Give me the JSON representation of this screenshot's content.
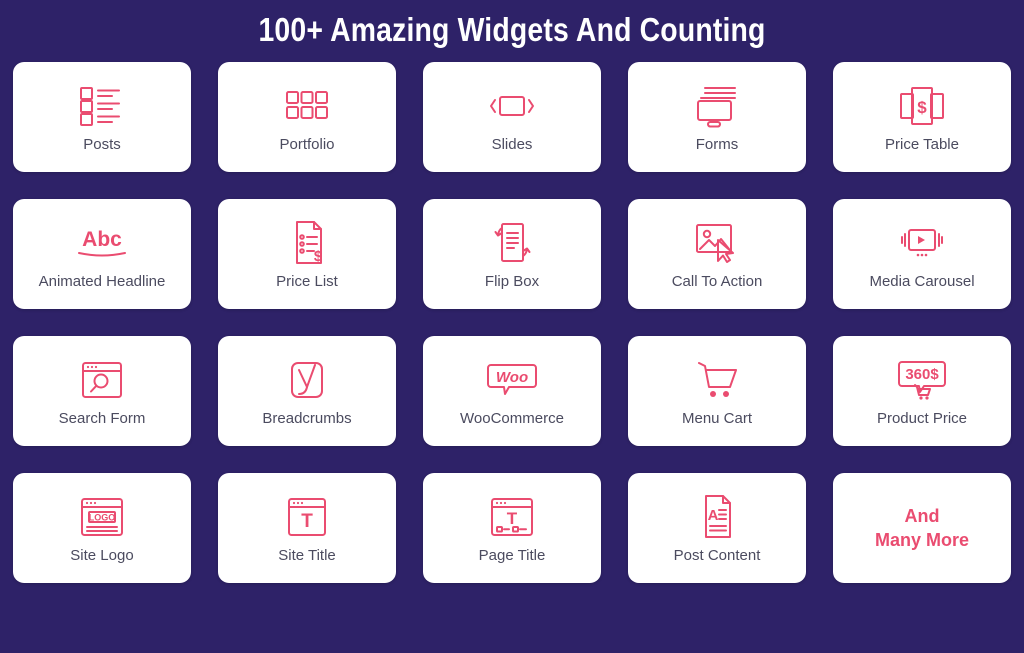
{
  "header": {
    "title": "100+ Amazing Widgets And Counting"
  },
  "theme": {
    "background": "#2e2268",
    "card_background": "#ffffff",
    "accent": "#ea4c70",
    "label_color": "#4b4b5f",
    "title_color": "#ffffff"
  },
  "grid": {
    "columns": 5,
    "rows": 4,
    "cards": [
      {
        "label": "Posts",
        "icon": "posts-icon"
      },
      {
        "label": "Portfolio",
        "icon": "portfolio-grid-icon"
      },
      {
        "label": "Slides",
        "icon": "slides-icon"
      },
      {
        "label": "Forms",
        "icon": "forms-monitor-icon"
      },
      {
        "label": "Price Table",
        "icon": "price-table-icon"
      },
      {
        "label": "Animated Headline",
        "icon": "abc-underline-icon"
      },
      {
        "label": "Price List",
        "icon": "price-list-document-icon"
      },
      {
        "label": "Flip Box",
        "icon": "flip-box-icon"
      },
      {
        "label": "Call To Action",
        "icon": "image-cursor-icon"
      },
      {
        "label": "Media Carousel",
        "icon": "media-carousel-play-icon"
      },
      {
        "label": "Search Form",
        "icon": "search-browser-icon"
      },
      {
        "label": "Breadcrumbs",
        "icon": "yoast-y-icon"
      },
      {
        "label": "WooCommerce",
        "icon": "woo-bubble-icon"
      },
      {
        "label": "Menu Cart",
        "icon": "shopping-cart-icon"
      },
      {
        "label": "Product Price",
        "icon": "product-price-tag-icon"
      },
      {
        "label": "Site Logo",
        "icon": "site-logo-browser-icon"
      },
      {
        "label": "Site Title",
        "icon": "site-title-browser-icon"
      },
      {
        "label": "Page Title",
        "icon": "page-title-browser-icon"
      },
      {
        "label": "Post Content",
        "icon": "post-content-document-icon"
      },
      {
        "label": "And\nMany More",
        "icon": "none",
        "is_more": true
      }
    ]
  },
  "icon_text": {
    "abc": "Abc",
    "woo": "Woo",
    "logo": "LOGO",
    "site_title_letter": "T",
    "page_title_letter": "T",
    "post_content_letter": "A",
    "price_table_currency": "$",
    "price_list_currency": "$",
    "product_price_value": "360$",
    "yoast_letter": "Y"
  },
  "more_card": {
    "line1": "And",
    "line2": "Many More"
  }
}
